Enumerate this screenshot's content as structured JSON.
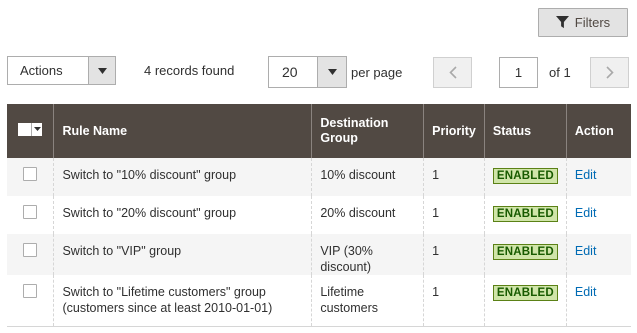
{
  "toolbar": {
    "filters_label": "Filters",
    "actions_label": "Actions",
    "records_found": "4 records found",
    "per_page_value": "20",
    "per_page_label": "per page",
    "current_page": "1",
    "of_pages": "of 1"
  },
  "grid": {
    "headers": {
      "rule_name": "Rule Name",
      "destination_group": "Destination Group",
      "priority": "Priority",
      "status": "Status",
      "action": "Action"
    },
    "rows": [
      {
        "rule_name": "Switch to \"10% discount\" group",
        "destination_group": "10% discount",
        "priority": "1",
        "status": "ENABLED",
        "action": "Edit"
      },
      {
        "rule_name": "Switch to \"20% discount\" group",
        "destination_group": "20% discount",
        "priority": "1",
        "status": "ENABLED",
        "action": "Edit"
      },
      {
        "rule_name": "Switch to \"VIP\" group",
        "destination_group": "VIP (30% discount)",
        "priority": "1",
        "status": "ENABLED",
        "action": "Edit"
      },
      {
        "rule_name": "Switch to \"Lifetime customers\" group (customers since at least 2010-01-01)",
        "destination_group": "Lifetime customers",
        "priority": "1",
        "status": "ENABLED",
        "action": "Edit"
      }
    ]
  },
  "colors": {
    "header_bg": "#514943",
    "status_bg": "#d0e5a9",
    "status_border": "#5b8116",
    "link": "#006bb4"
  },
  "icons": {
    "filters": "funnel-icon",
    "dropdown": "caret-down-icon",
    "prev": "chevron-left-icon",
    "next": "chevron-right-icon"
  }
}
